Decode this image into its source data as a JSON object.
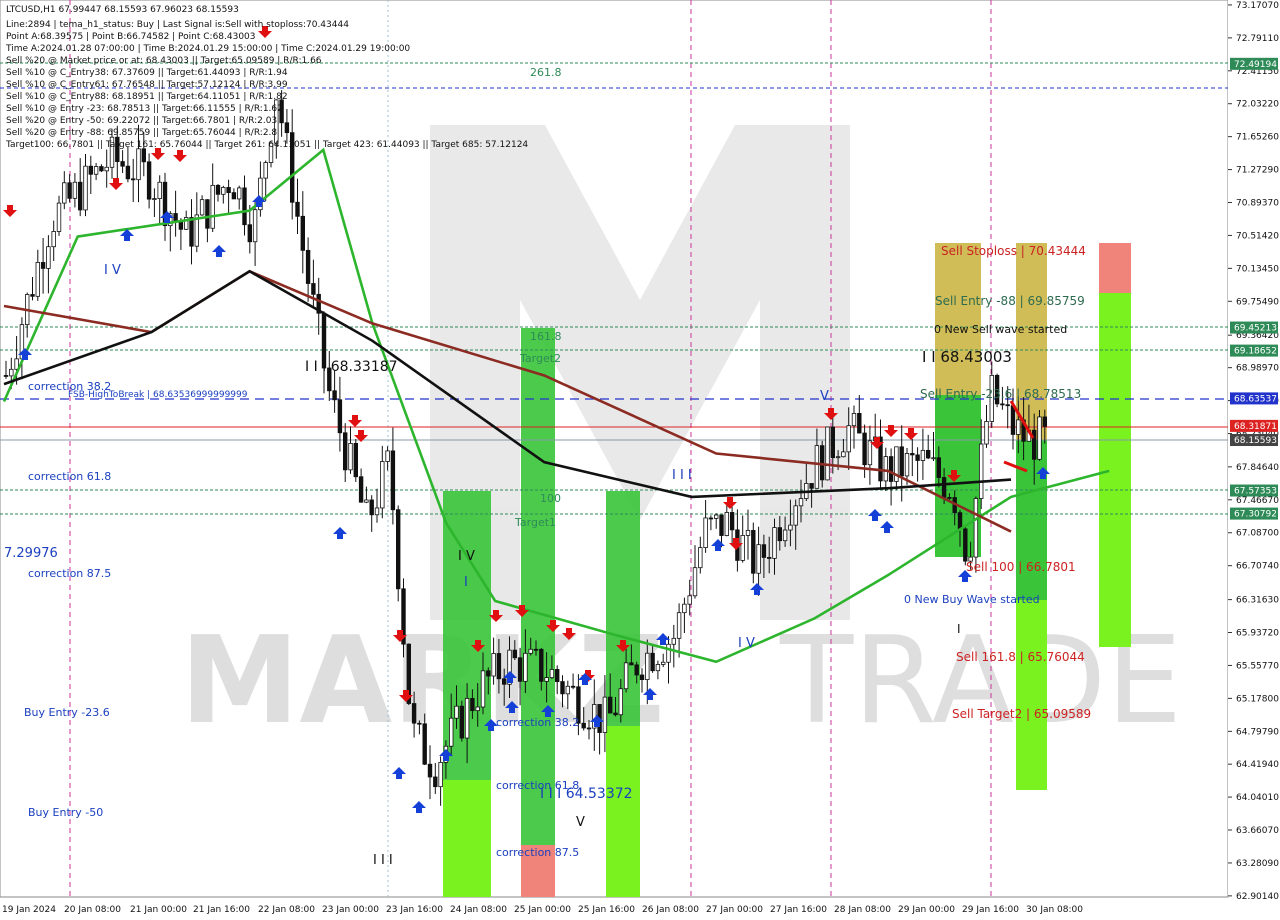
{
  "info_lines": [
    "LTCUSD,H1  67.99447 68.15593 67.96023 68.15593",
    "Line:2894  | tema_h1_status: Buy  | Last Signal is:Sell with stoploss:70.43444",
    "Point A:68.39575  | Point B:66.74582  | Point C:68.43003",
    "Time A:2024.01.28 07:00:00  | Time B:2024.01.29 15:00:00  | Time C:2024.01.29 19:00:00",
    "Sell %20 @ Market price or at: 68.43003  || Target:65.09589  | R/R:1.66",
    "Sell %10 @ C_Entry38: 67.37609  || Target:61.44093  | R/R:1.94",
    "Sell %10 @ C_Entry61: 67.76548  || Target:57.12124  | R/R:3.99",
    "Sell %10 @ C_Entry88: 68.18951  || Target:64.11051  | R/R:1.82",
    "Sell %10 @ Entry -23: 68.78513  || Target:66.11555  | R/R:1.62",
    "Sell %20 @ Entry -50: 69.22072  || Target:66.7801  | R/R:2.03",
    "Sell %20 @ Entry -88: 69.85759  || Target:65.76044  | R/R:2.8",
    "Target100: 66.7801  || Target 161: 65.76044  || Target 261: 64.11051  || Target 423: 61.44093  || Target 685: 57.12124"
  ],
  "watermark": {
    "left": "MARKZ",
    "right": "TRADE"
  },
  "y_axis": {
    "min": 62.9,
    "max": 73.17,
    "ticks": [
      "73.17070",
      "72.79110",
      "72.41150",
      "72.03220",
      "71.65260",
      "71.27290",
      "70.89370",
      "70.51420",
      "70.13450",
      "69.75490",
      "69.36420",
      "68.98970",
      "68.61010",
      "68.23040",
      "67.84640",
      "67.46670",
      "67.08700",
      "66.70740",
      "66.31630",
      "65.93720",
      "65.55770",
      "65.17800",
      "64.79790",
      "64.41940",
      "64.04010",
      "63.66070",
      "63.28090",
      "62.90140"
    ]
  },
  "x_axis": {
    "labels": [
      "19 Jan 2024",
      "20 Jan 08:00",
      "21 Jan 00:00",
      "21 Jan 16:00",
      "22 Jan 08:00",
      "23 Jan 00:00",
      "23 Jan 16:00",
      "24 Jan 08:00",
      "25 Jan 00:00",
      "25 Jan 16:00",
      "26 Jan 08:00",
      "27 Jan 00:00",
      "27 Jan 16:00",
      "28 Jan 08:00",
      "29 Jan 00:00",
      "29 Jan 16:00",
      "30 Jan 08:00"
    ]
  },
  "price_tags": [
    {
      "value": 72.49194,
      "label": "72.49194",
      "color": "#2e8b57"
    },
    {
      "value": 69.45213,
      "label": "69.45213",
      "color": "#2e8b57"
    },
    {
      "value": 69.18652,
      "label": "69.18652",
      "color": "#2e8b57"
    },
    {
      "value": 68.63537,
      "label": "68.63537",
      "color": "#2233cc"
    },
    {
      "value": 68.31871,
      "label": "68.31871",
      "color": "#dd2222"
    },
    {
      "value": 68.15593,
      "label": "68.15593",
      "color": "#444444"
    },
    {
      "value": 67.57353,
      "label": "67.57353",
      "color": "#2e8b57"
    },
    {
      "value": 67.30792,
      "label": "67.30792",
      "color": "#2e8b57"
    }
  ],
  "annotations": [
    {
      "text": "261.8",
      "color": "#2e8b57"
    },
    {
      "text": "161.8",
      "color": "#2e8b57"
    },
    {
      "text": "Target2",
      "color": "#2e8b57"
    },
    {
      "text": "100",
      "color": "#2e8b57"
    },
    {
      "text": "Target1",
      "color": "#2e8b57"
    },
    {
      "text": "correction 38.2",
      "color": "#1a3fbf"
    },
    {
      "text": "FSB-HighToBreak  | 68.63536999999999",
      "color": "#1a3fbf"
    },
    {
      "text": "correction 61.8",
      "color": "#1a3fbf"
    },
    {
      "text": "7.29976",
      "color": "#1a3fbf"
    },
    {
      "text": "correction 87.5",
      "color": "#1a3fbf"
    },
    {
      "text": "Buy Entry -23.6",
      "color": "#1a3fbf"
    },
    {
      "text": "Buy Entry -50",
      "color": "#1a3fbf"
    },
    {
      "text": "I V",
      "color": "#1a3fbf"
    },
    {
      "text": "I I I  68.33187",
      "color": "#111111"
    },
    {
      "text": "I V",
      "color": "#111111"
    },
    {
      "text": "I",
      "color": "#1a3fbf"
    },
    {
      "text": "correction 38.2",
      "color": "#1a3fbf"
    },
    {
      "text": "correction 61.8",
      "color": "#1a3fbf"
    },
    {
      "text": "I I I  64.53372",
      "color": "#1a3fbf"
    },
    {
      "text": "V",
      "color": "#111111"
    },
    {
      "text": "correction 87.5",
      "color": "#1a3fbf"
    },
    {
      "text": "I I I",
      "color": "#111111"
    },
    {
      "text": "I I I",
      "color": "#1a3fbf"
    },
    {
      "text": "I V",
      "color": "#1a3fbf"
    },
    {
      "text": "V",
      "color": "#1a3fbf"
    },
    {
      "text": "Sell Stoploss  | 70.43444",
      "color": "#cc2222"
    },
    {
      "text": "Sell Entry -88  | 69.85759",
      "color": "#2e6b4f"
    },
    {
      "text": "0 New Sell wave started",
      "color": "#111111"
    },
    {
      "text": "I I 68.43003",
      "color": "#111111"
    },
    {
      "text": "Sell Entry -23.6  | 68.78513",
      "color": "#2e6b4f"
    },
    {
      "text": "Sell 100  | 66.7801",
      "color": "#cc2222"
    },
    {
      "text": "0 New Buy Wave started",
      "color": "#1a3fbf"
    },
    {
      "text": "I",
      "color": "#111111"
    },
    {
      "text": "Sell 161.8  | 65.76044",
      "color": "#cc2222"
    },
    {
      "text": "Sell Target2  | 65.09589",
      "color": "#cc2222"
    }
  ],
  "chart_data": {
    "type": "candlestick",
    "symbol": "LTCUSD",
    "timeframe": "H1",
    "ohlc_last": {
      "open": 67.99447,
      "high": 68.15593,
      "low": 67.96023,
      "close": 68.15593
    },
    "y_range": [
      62.9,
      73.17
    ],
    "x_range": [
      "19 Jan 2024",
      "30 Jan 08:00"
    ],
    "close_path": [
      [
        "19 Jan 2024",
        68.9
      ],
      [
        "19 Jan 12:00",
        70.7
      ],
      [
        "20 Jan 04:00",
        71.4
      ],
      [
        "20 Jan 14:00",
        71.2
      ],
      [
        "21 Jan 00:00",
        70.5
      ],
      [
        "21 Jan 12:00",
        71.2
      ],
      [
        "21 Jan 18:00",
        70.6
      ],
      [
        "22 Jan 00:00",
        72.2
      ],
      [
        "22 Jan 08:00",
        70.1
      ],
      [
        "22 Jan 14:00",
        68.7
      ],
      [
        "23 Jan 00:00",
        67.2
      ],
      [
        "23 Jan 06:00",
        67.9
      ],
      [
        "23 Jan 12:00",
        64.8
      ],
      [
        "23 Jan 18:00",
        64.4
      ],
      [
        "24 Jan 06:00",
        65.3
      ],
      [
        "24 Jan 14:00",
        65.6
      ],
      [
        "25 Jan 00:00",
        65.5
      ],
      [
        "25 Jan 10:00",
        65.1
      ],
      [
        "25 Jan 16:00",
        64.9
      ],
      [
        "26 Jan 00:00",
        65.6
      ],
      [
        "26 Jan 10:00",
        65.9
      ],
      [
        "26 Jan 18:00",
        67.1
      ],
      [
        "27 Jan 00:00",
        67.2
      ],
      [
        "27 Jan 08:00",
        66.7
      ],
      [
        "27 Jan 16:00",
        67.4
      ],
      [
        "28 Jan 00:00",
        67.9
      ],
      [
        "28 Jan 08:00",
        68.3
      ],
      [
        "28 Jan 18:00",
        67.8
      ],
      [
        "29 Jan 04:00",
        67.9
      ],
      [
        "29 Jan 12:00",
        67.6
      ],
      [
        "29 Jan 16:00",
        66.8
      ],
      [
        "29 Jan 22:00",
        68.7
      ],
      [
        "30 Jan 04:00",
        68.3
      ],
      [
        "30 Jan 08:00",
        68.15593
      ]
    ],
    "moving_averages": [
      {
        "color": "#2db52d",
        "values": [
          [
            0,
            68.6
          ],
          [
            0.06,
            70.5
          ],
          [
            0.2,
            70.8
          ],
          [
            0.26,
            71.5
          ],
          [
            0.3,
            69.5
          ],
          [
            0.36,
            67.2
          ],
          [
            0.4,
            66.3
          ],
          [
            0.5,
            65.9
          ],
          [
            0.58,
            65.6
          ],
          [
            0.66,
            66.1
          ],
          [
            0.72,
            66.6
          ],
          [
            0.82,
            67.5
          ],
          [
            0.9,
            67.8
          ]
        ]
      },
      {
        "color": "#8b2b22",
        "values": [
          [
            0,
            69.7
          ],
          [
            0.12,
            69.4
          ],
          [
            0.2,
            70.1
          ],
          [
            0.3,
            69.5
          ],
          [
            0.44,
            68.9
          ],
          [
            0.58,
            68.0
          ],
          [
            0.72,
            67.8
          ],
          [
            0.82,
            67.1
          ]
        ]
      },
      {
        "color": "#111111",
        "values": [
          [
            0,
            68.8
          ],
          [
            0.12,
            69.4
          ],
          [
            0.2,
            70.1
          ],
          [
            0.3,
            69.3
          ],
          [
            0.44,
            67.9
          ],
          [
            0.56,
            67.5
          ],
          [
            0.72,
            67.6
          ],
          [
            0.82,
            67.7
          ]
        ]
      }
    ]
  }
}
